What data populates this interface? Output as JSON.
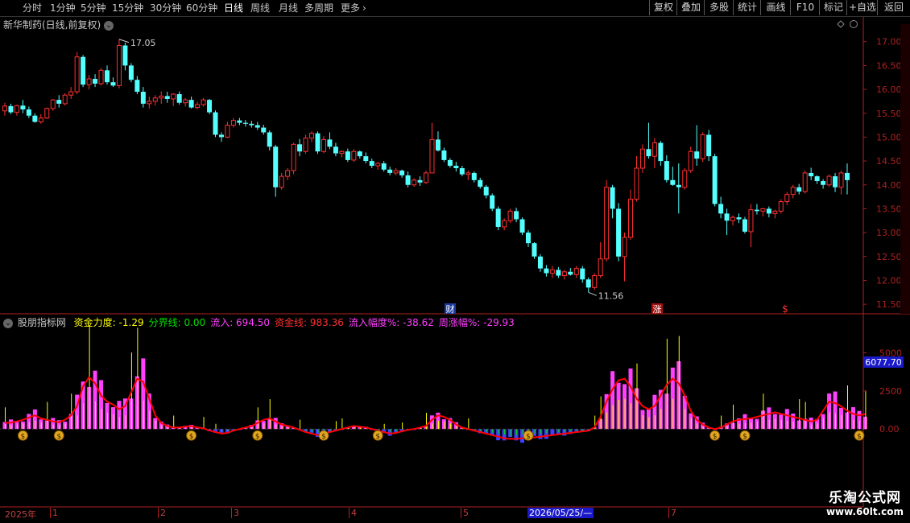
{
  "toolbar": {
    "periods": [
      "分时",
      "1分钟",
      "5分钟",
      "15分钟",
      "30分钟",
      "60分钟",
      "日线",
      "周线",
      "月线",
      "多周期",
      "更多"
    ],
    "active_period": "日线",
    "more_chevron": "›",
    "right_buttons": [
      "复权",
      "叠加",
      "多股",
      "统计",
      "画线",
      "F10",
      "标记",
      "+自选",
      "返回"
    ]
  },
  "main_chart": {
    "title": "新华制药(日线,前复权)",
    "price_high_label": "17.05",
    "price_low_label": "11.56",
    "marker_cai": "财",
    "marker_zhang": "涨",
    "marker_dollar": "$",
    "y_ticks": [
      "17.00",
      "16.50",
      "16.00",
      "15.50",
      "15.00",
      "14.50",
      "14.00",
      "13.50",
      "13.00",
      "12.50",
      "12.00",
      "11.50"
    ]
  },
  "indicator": {
    "name": "股朋指标网",
    "fields": [
      {
        "label": "资金力度:",
        "value": "-1.29",
        "color": "#ffff00"
      },
      {
        "label": "分界线:",
        "value": "0.00",
        "color": "#00e000"
      },
      {
        "label": "流入:",
        "value": "694.50",
        "color": "#ff40ff"
      },
      {
        "label": "资金线:",
        "value": "983.36",
        "color": "#ff3030"
      },
      {
        "label": "流入幅度%:",
        "value": "-38.62",
        "color": "#ff40ff"
      },
      {
        "label": "周涨幅%:",
        "value": "-29.93",
        "color": "#ff40ff"
      }
    ],
    "y_ticks": [
      "5000",
      "2500",
      "0.00"
    ],
    "current_value_box": "6077.70"
  },
  "date_axis": {
    "labels": [
      "2025年",
      "1",
      "2",
      "3",
      "4",
      "5",
      "7"
    ],
    "cursor_date": "2026/05/25/—"
  },
  "watermark": {
    "line1": "乐淘公式网",
    "line2": "www.60lt.com"
  },
  "colors": {
    "up": "#ff3030",
    "down": "#54ffff",
    "axis": "#b02020",
    "flow_in": "#ff40ff",
    "flow_out": "#4040ff",
    "fund_line": "#ff0000",
    "strength": "#ffff00",
    "divider": "#00e000"
  },
  "chart_data": {
    "type": "candlestick",
    "series": [
      {
        "name": "新华制药(日线,前复权)",
        "ohlc": [
          [
            15.55,
            15.72,
            15.45,
            15.65
          ],
          [
            15.65,
            15.7,
            15.48,
            15.52
          ],
          [
            15.52,
            15.68,
            15.45,
            15.66
          ],
          [
            15.66,
            15.78,
            15.5,
            15.58
          ],
          [
            15.58,
            15.64,
            15.4,
            15.45
          ],
          [
            15.45,
            15.5,
            15.3,
            15.32
          ],
          [
            15.32,
            15.48,
            15.28,
            15.4
          ],
          [
            15.4,
            15.62,
            15.38,
            15.6
          ],
          [
            15.6,
            15.8,
            15.55,
            15.78
          ],
          [
            15.78,
            15.88,
            15.62,
            15.7
          ],
          [
            15.7,
            15.92,
            15.66,
            15.88
          ],
          [
            15.88,
            16.05,
            15.8,
            15.95
          ],
          [
            15.95,
            16.78,
            15.9,
            16.68
          ],
          [
            16.68,
            16.72,
            16.05,
            16.1
          ],
          [
            16.1,
            16.3,
            16.0,
            16.22
          ],
          [
            16.22,
            16.32,
            16.05,
            16.12
          ],
          [
            16.12,
            16.45,
            16.08,
            16.4
          ],
          [
            16.4,
            16.5,
            16.1,
            16.15
          ],
          [
            16.15,
            16.25,
            16.05,
            16.08
          ],
          [
            16.08,
            17.05,
            16.02,
            16.92
          ],
          [
            16.92,
            16.98,
            16.4,
            16.5
          ],
          [
            16.5,
            16.55,
            16.15,
            16.2
          ],
          [
            16.2,
            16.28,
            15.9,
            15.95
          ],
          [
            15.95,
            16.05,
            15.62,
            15.7
          ],
          [
            15.7,
            15.85,
            15.6,
            15.75
          ],
          [
            15.75,
            15.88,
            15.66,
            15.82
          ],
          [
            15.82,
            15.96,
            15.7,
            15.86
          ],
          [
            15.86,
            15.95,
            15.72,
            15.8
          ],
          [
            15.8,
            15.92,
            15.65,
            15.9
          ],
          [
            15.9,
            15.96,
            15.68,
            15.72
          ],
          [
            15.72,
            15.82,
            15.64,
            15.78
          ],
          [
            15.78,
            15.85,
            15.6,
            15.62
          ],
          [
            15.62,
            15.74,
            15.58,
            15.68
          ],
          [
            15.68,
            15.82,
            15.64,
            15.78
          ],
          [
            15.78,
            15.8,
            15.48,
            15.52
          ],
          [
            15.52,
            15.56,
            15.0,
            15.05
          ],
          [
            15.05,
            15.1,
            14.9,
            15.0
          ],
          [
            15.0,
            15.32,
            14.98,
            15.25
          ],
          [
            15.25,
            15.4,
            15.2,
            15.35
          ],
          [
            15.35,
            15.4,
            15.25,
            15.3
          ],
          [
            15.3,
            15.36,
            15.22,
            15.28
          ],
          [
            15.28,
            15.34,
            15.2,
            15.25
          ],
          [
            15.25,
            15.32,
            15.15,
            15.2
          ],
          [
            15.2,
            15.26,
            15.05,
            15.1
          ],
          [
            15.1,
            15.14,
            14.72,
            14.8
          ],
          [
            14.8,
            14.84,
            13.75,
            13.95
          ],
          [
            13.95,
            14.25,
            13.9,
            14.18
          ],
          [
            14.18,
            14.35,
            14.1,
            14.3
          ],
          [
            14.3,
            14.88,
            14.22,
            14.85
          ],
          [
            14.85,
            14.96,
            14.6,
            14.7
          ],
          [
            14.7,
            15.05,
            14.65,
            14.98
          ],
          [
            14.98,
            15.12,
            14.9,
            15.08
          ],
          [
            15.08,
            15.12,
            14.65,
            14.7
          ],
          [
            14.7,
            15.02,
            14.66,
            14.95
          ],
          [
            14.95,
            15.1,
            14.75,
            14.8
          ],
          [
            14.8,
            14.88,
            14.6,
            14.66
          ],
          [
            14.66,
            14.72,
            14.58,
            14.7
          ],
          [
            14.7,
            14.76,
            14.48,
            14.52
          ],
          [
            14.52,
            14.75,
            14.48,
            14.7
          ],
          [
            14.7,
            14.72,
            14.55,
            14.6
          ],
          [
            14.6,
            14.68,
            14.45,
            14.5
          ],
          [
            14.5,
            14.55,
            14.35,
            14.4
          ],
          [
            14.4,
            14.48,
            14.32,
            14.45
          ],
          [
            14.45,
            14.5,
            14.28,
            14.32
          ],
          [
            14.32,
            14.38,
            14.2,
            14.25
          ],
          [
            14.25,
            14.35,
            14.2,
            14.3
          ],
          [
            14.3,
            14.32,
            14.15,
            14.2
          ],
          [
            14.2,
            14.28,
            13.95,
            14.0
          ],
          [
            14.0,
            14.14,
            13.96,
            14.1
          ],
          [
            14.1,
            14.18,
            13.98,
            14.05
          ],
          [
            14.05,
            14.3,
            14.02,
            14.25
          ],
          [
            14.25,
            15.3,
            14.6,
            14.95
          ],
          [
            14.95,
            15.12,
            14.7,
            14.72
          ],
          [
            14.72,
            14.78,
            14.48,
            14.52
          ],
          [
            14.52,
            14.56,
            14.36,
            14.4
          ],
          [
            14.4,
            14.48,
            14.28,
            14.35
          ],
          [
            14.35,
            14.4,
            14.18,
            14.22
          ],
          [
            14.22,
            14.3,
            14.1,
            14.25
          ],
          [
            14.25,
            14.28,
            14.05,
            14.1
          ],
          [
            14.1,
            14.15,
            13.92,
            13.96
          ],
          [
            13.96,
            14.0,
            13.72,
            13.78
          ],
          [
            13.78,
            13.82,
            13.45,
            13.5
          ],
          [
            13.5,
            13.55,
            13.05,
            13.12
          ],
          [
            13.12,
            13.3,
            13.05,
            13.25
          ],
          [
            13.25,
            13.5,
            13.2,
            13.45
          ],
          [
            13.45,
            13.52,
            13.22,
            13.28
          ],
          [
            13.28,
            13.32,
            12.95,
            13.0
          ],
          [
            13.0,
            13.05,
            12.7,
            12.78
          ],
          [
            12.78,
            12.8,
            12.45,
            12.5
          ],
          [
            12.5,
            12.55,
            12.18,
            12.25
          ],
          [
            12.25,
            12.32,
            12.08,
            12.15
          ],
          [
            12.15,
            12.3,
            12.05,
            12.22
          ],
          [
            12.22,
            12.28,
            12.05,
            12.1
          ],
          [
            12.1,
            12.22,
            12.02,
            12.18
          ],
          [
            12.18,
            12.26,
            12.1,
            12.12
          ],
          [
            12.12,
            12.3,
            12.05,
            12.25
          ],
          [
            12.25,
            12.3,
            11.95,
            12.02
          ],
          [
            12.02,
            12.06,
            11.75,
            11.85
          ],
          [
            11.85,
            12.15,
            11.8,
            12.1
          ],
          [
            12.1,
            12.8,
            12.05,
            12.45
          ],
          [
            12.45,
            14.1,
            12.4,
            13.95
          ],
          [
            13.95,
            14.0,
            13.3,
            13.5
          ],
          [
            13.5,
            13.62,
            12.4,
            12.5
          ],
          [
            12.5,
            13.0,
            11.98,
            12.9
          ],
          [
            12.9,
            13.9,
            12.85,
            13.7
          ],
          [
            13.7,
            14.6,
            13.65,
            14.35
          ],
          [
            14.35,
            14.85,
            14.25,
            14.75
          ],
          [
            14.75,
            15.3,
            14.55,
            14.6
          ],
          [
            14.6,
            14.98,
            14.35,
            14.88
          ],
          [
            14.88,
            14.92,
            14.4,
            14.5
          ],
          [
            14.5,
            14.62,
            14.05,
            14.1
          ],
          [
            14.1,
            14.38,
            13.98,
            14.0
          ],
          [
            14.0,
            14.45,
            13.4,
            13.95
          ],
          [
            13.95,
            14.35,
            13.9,
            14.3
          ],
          [
            14.3,
            14.8,
            14.25,
            14.7
          ],
          [
            14.7,
            15.25,
            14.4,
            14.55
          ],
          [
            14.55,
            15.1,
            14.48,
            15.05
          ],
          [
            15.05,
            15.15,
            14.5,
            14.6
          ],
          [
            14.6,
            14.65,
            13.55,
            13.6
          ],
          [
            13.6,
            13.75,
            13.3,
            13.4
          ],
          [
            13.4,
            13.5,
            12.95,
            13.25
          ],
          [
            13.25,
            13.36,
            13.15,
            13.32
          ],
          [
            13.32,
            13.4,
            13.2,
            13.28
          ],
          [
            13.28,
            13.33,
            12.98,
            13.02
          ],
          [
            13.02,
            13.6,
            12.7,
            13.48
          ],
          [
            13.48,
            13.6,
            13.38,
            13.45
          ],
          [
            13.45,
            13.52,
            13.34,
            13.5
          ],
          [
            13.5,
            13.55,
            13.32,
            13.4
          ],
          [
            13.4,
            13.48,
            13.3,
            13.45
          ],
          [
            13.45,
            13.7,
            13.4,
            13.65
          ],
          [
            13.65,
            13.85,
            13.58,
            13.8
          ],
          [
            13.8,
            14.0,
            13.72,
            13.95
          ],
          [
            13.95,
            14.02,
            13.8,
            13.86
          ],
          [
            13.86,
            14.3,
            13.82,
            14.25
          ],
          [
            14.25,
            14.36,
            14.1,
            14.18
          ],
          [
            14.18,
            14.2,
            14.02,
            14.08
          ],
          [
            14.08,
            14.12,
            13.92,
            14.0
          ],
          [
            14.0,
            14.22,
            13.96,
            14.18
          ],
          [
            14.18,
            14.25,
            13.85,
            13.95
          ],
          [
            13.95,
            14.3,
            13.8,
            14.25
          ],
          [
            14.25,
            14.45,
            13.8,
            14.1
          ]
        ]
      }
    ],
    "indicator_series": {
      "name": "资金线",
      "values": [
        400,
        420,
        500,
        600,
        750,
        900,
        700,
        600,
        500,
        450,
        600,
        900,
        1500,
        2800,
        3400,
        3000,
        2200,
        1800,
        1600,
        1300,
        1500,
        2400,
        3300,
        3100,
        2000,
        900,
        400,
        200,
        100,
        100,
        150,
        200,
        100,
        50,
        -100,
        -200,
        -300,
        -250,
        -100,
        0,
        100,
        200,
        400,
        600,
        700,
        500,
        300,
        200,
        100,
        -50,
        -200,
        -300,
        -400,
        -300,
        -200,
        -100,
        0,
        100,
        200,
        150,
        100,
        0,
        -100,
        -200,
        -300,
        -250,
        -150,
        -50,
        0,
        100,
        200,
        600,
        900,
        800,
        600,
        300,
        100,
        0,
        -100,
        -200,
        -300,
        -400,
        -500,
        -600,
        -650,
        -650,
        -600,
        -600,
        -550,
        -500,
        -450,
        -400,
        -350,
        -300,
        -250,
        -200,
        -150,
        -100,
        100,
        800,
        1800,
        2600,
        3200,
        3300,
        2800,
        2000,
        1500,
        1300,
        1500,
        2200,
        2900,
        3300,
        3000,
        2200,
        1200,
        600,
        300,
        100,
        0,
        100,
        300,
        500,
        600,
        650,
        700,
        800,
        900,
        1000,
        1100,
        1000,
        900,
        800,
        700,
        600,
        500,
        600,
        1200,
        1800,
        1700,
        1500,
        1200,
        1000,
        900,
        983
      ]
    },
    "ylim_price": [
      11.3,
      17.4
    ],
    "ylim_indicator": [
      -5000,
      6500
    ]
  }
}
